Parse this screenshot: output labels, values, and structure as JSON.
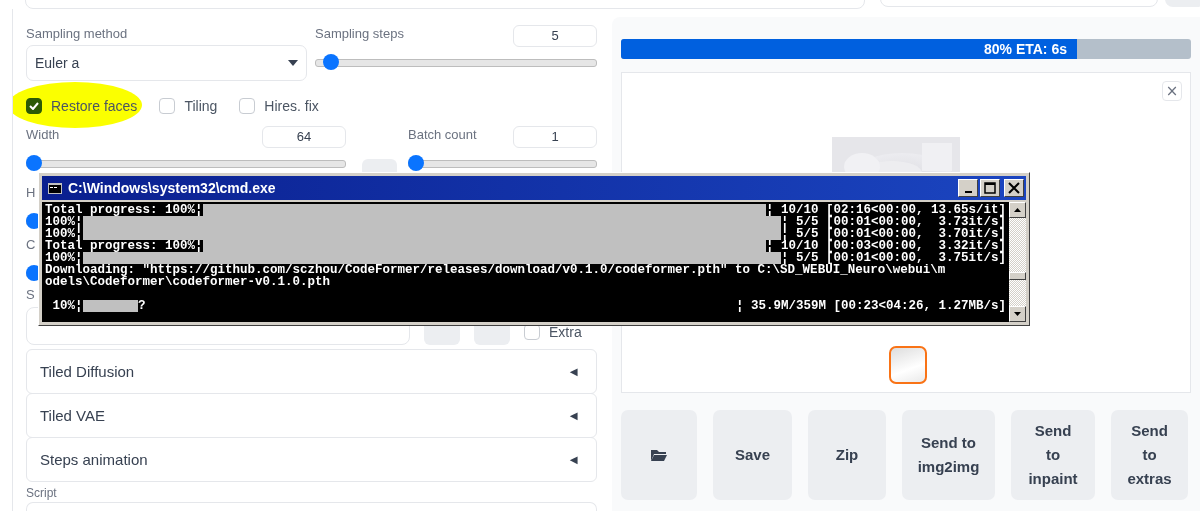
{
  "sampling_method": {
    "label": "Sampling method",
    "value": "Euler a"
  },
  "sampling_steps": {
    "label": "Sampling steps",
    "value": "5",
    "level": 0.03
  },
  "checkboxes": [
    {
      "label": "Restore faces",
      "checked": true,
      "highlighted": true
    },
    {
      "label": "Tiling",
      "checked": false,
      "highlighted": false
    },
    {
      "label": "Hires. fix",
      "checked": false,
      "highlighted": false
    }
  ],
  "width": {
    "label": "Width",
    "value": "64",
    "level": 0
  },
  "batch_count": {
    "label": "Batch count",
    "value": "1",
    "level": 0
  },
  "height": {
    "label": "H",
    "level": 0
  },
  "cfg": {
    "label": "C",
    "level": 0
  },
  "seed": {
    "label": "S"
  },
  "extra": {
    "label": "Extra",
    "checked": false
  },
  "accordions": [
    {
      "label": "Tiled Diffusion",
      "arrow": "◄"
    },
    {
      "label": "Tiled VAE",
      "arrow": "◄"
    },
    {
      "label": "Steps animation",
      "arrow": "◄"
    }
  ],
  "script": {
    "label": "Script"
  },
  "progress": {
    "level": 0.8,
    "text": "80% ETA: 6s"
  },
  "gallery": {
    "close": "×",
    "thumbnails": [
      {
        "selected": true
      }
    ]
  },
  "buttons": [
    {
      "kind": "icon"
    },
    {
      "kind": "text",
      "label": "Save"
    },
    {
      "kind": "text",
      "label": "Zip"
    },
    {
      "kind": "text",
      "label": "Send to\nimg2img"
    },
    {
      "kind": "text",
      "label": "Send\nto\ninpaint"
    },
    {
      "kind": "text",
      "label": "Send\nto\nextras"
    }
  ],
  "console": {
    "title": "C:\\Windows\\system32\\cmd.exe",
    "lines": [
      {
        "kind": "done",
        "prefix": "Total progress: 100%¦",
        "suffix": "¦ 10/10 [02:16<00:00, 13.65s/it]"
      },
      {
        "kind": "done",
        "prefix": "100%¦",
        "suffix": "¦ 5/5 [00:01<00:00,  3.73it/s]"
      },
      {
        "kind": "done",
        "prefix": "100%¦",
        "suffix": "¦ 5/5 [00:01<00:00,  3.70it/s]"
      },
      {
        "kind": "done",
        "prefix": "Total progress: 100%¦",
        "suffix": "¦ 10/10 [00:03<00:00,  3.32it/s]"
      },
      {
        "kind": "done",
        "prefix": "100%¦",
        "suffix": "¦ 5/5 [00:01<00:00,  3.75it/s]"
      },
      {
        "kind": "text",
        "text": "Downloading: \"https://github.com/sczhou/CodeFormer/releases/download/v0.1.0/codeformer.pth\" to C:\\SD_WEBUI_Neuro\\webui\\m"
      },
      {
        "kind": "text",
        "text": "odels\\Codeformer\\codeformer-v0.1.0.pth"
      },
      {
        "kind": "blank"
      },
      {
        "kind": "progress",
        "prefix": " 10%¦",
        "level": 0.085,
        "tail": "?",
        "suffix": "¦ 35.9M/359M [00:23<04:26, 1.27MB/s]"
      }
    ]
  }
}
